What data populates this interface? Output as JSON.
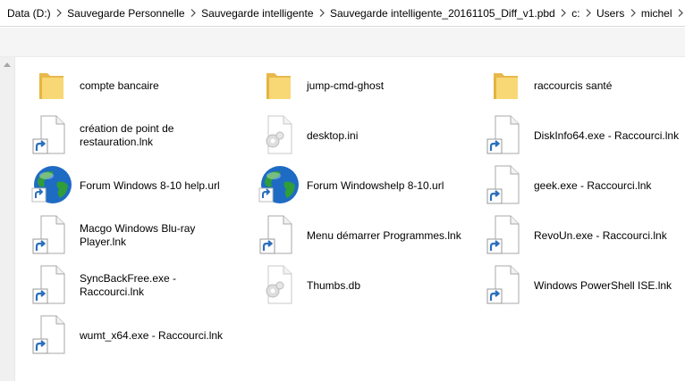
{
  "breadcrumb": [
    "Data (D:)",
    "Sauvegarde Personnelle",
    "Sauvegarde intelligente",
    "Sauvegarde intelligente_20161105_Diff_v1.pbd",
    "c:",
    "Users",
    "michel"
  ],
  "files": [
    {
      "name": "compte bancaire",
      "icon": "folder-icon"
    },
    {
      "name": "jump-cmd-ghost",
      "icon": "folder-icon"
    },
    {
      "name": "raccourcis santé",
      "icon": "folder-icon"
    },
    {
      "name": "création de point de restauration.lnk",
      "icon": "shortcut-icon"
    },
    {
      "name": "desktop.ini",
      "icon": "settings-file-icon"
    },
    {
      "name": "DiskInfo64.exe - Raccourci.lnk",
      "icon": "shortcut-icon"
    },
    {
      "name": "Forum Windows 8-10 help.url",
      "icon": "globe-icon"
    },
    {
      "name": "Forum Windowshelp 8-10.url",
      "icon": "globe-icon"
    },
    {
      "name": "geek.exe - Raccourci.lnk",
      "icon": "shortcut-icon"
    },
    {
      "name": "Macgo Windows Blu-ray Player.lnk",
      "icon": "shortcut-icon"
    },
    {
      "name": "Menu démarrer Programmes.lnk",
      "icon": "shortcut-icon"
    },
    {
      "name": "RevoUn.exe - Raccourci.lnk",
      "icon": "shortcut-icon"
    },
    {
      "name": "SyncBackFree.exe - Raccourci.lnk",
      "icon": "shortcut-icon"
    },
    {
      "name": "Thumbs.db",
      "icon": "settings-file-icon"
    },
    {
      "name": "Windows PowerShell ISE.lnk",
      "icon": "shortcut-icon"
    },
    {
      "name": "wumt_x64.exe - Raccourci.lnk",
      "icon": "shortcut-icon"
    }
  ],
  "colors": {
    "folder": "#f8d775",
    "folder_dark": "#e8b84b",
    "shortcut_arrow": "#2a6fbd",
    "globe_blue": "#1e6bc4",
    "globe_green": "#2e9d3a"
  }
}
